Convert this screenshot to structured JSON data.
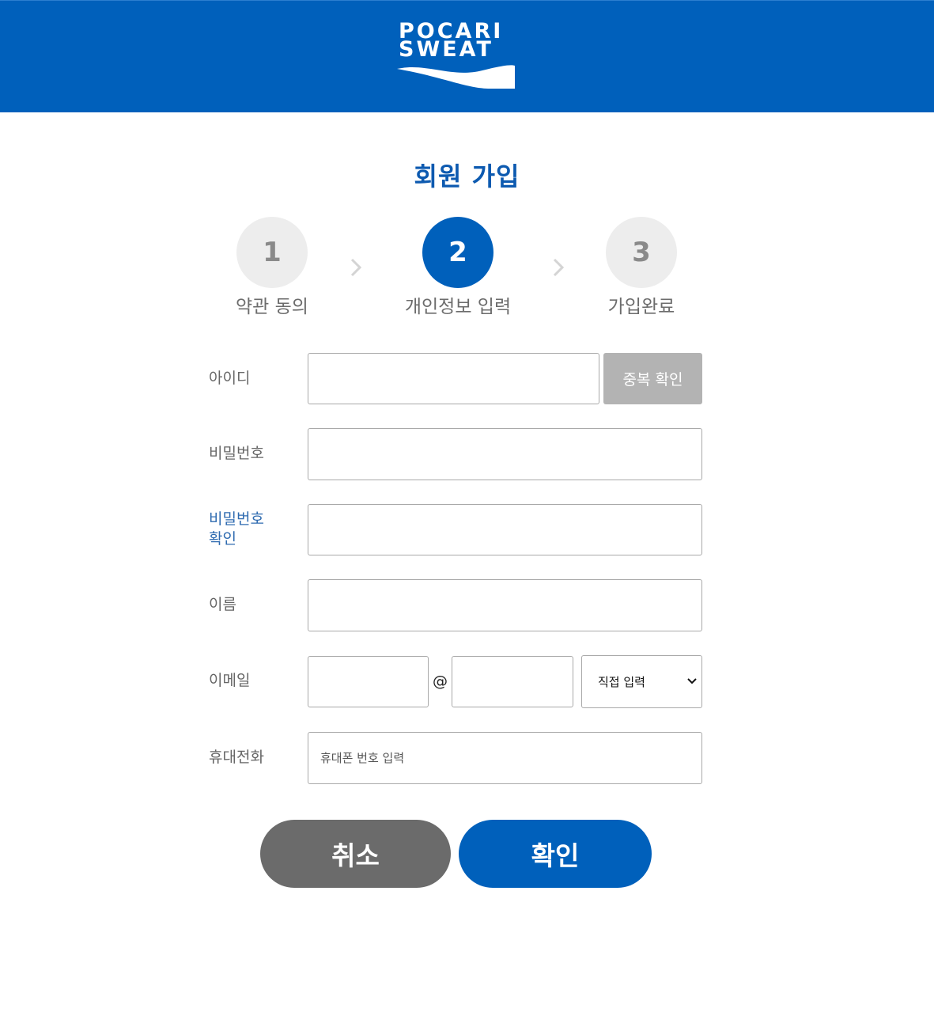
{
  "header": {
    "logo_line1": "POCARI",
    "logo_line2": "SWEAT",
    "background_color": "#0060bb"
  },
  "page_title": "회원 가입",
  "steps": [
    {
      "number": "1",
      "label": "약관 동의",
      "active": false
    },
    {
      "number": "2",
      "label": "개인정보 입력",
      "active": true
    },
    {
      "number": "3",
      "label": "가입완료",
      "active": false
    }
  ],
  "form": {
    "id_label": "아이디",
    "id_value": "",
    "duplicate_check_label": "중복 확인",
    "password_label": "비밀번호",
    "password_value": "",
    "password_confirm_label_line1": "비밀번호",
    "password_confirm_label_line2": "확인",
    "password_confirm_value": "",
    "name_label": "이름",
    "name_value": "",
    "email_label": "이메일",
    "email_local_value": "",
    "email_at": "@",
    "email_domain_value": "",
    "email_domain_select": "직접 입력",
    "phone_label": "휴대전화",
    "phone_placeholder": "휴대폰 번호 입력"
  },
  "buttons": {
    "cancel_label": "취소",
    "confirm_label": "확인"
  },
  "colors": {
    "accent": "#0060bb",
    "cancel": "#6b6b6b",
    "disabled_button": "#b3b3b3"
  }
}
